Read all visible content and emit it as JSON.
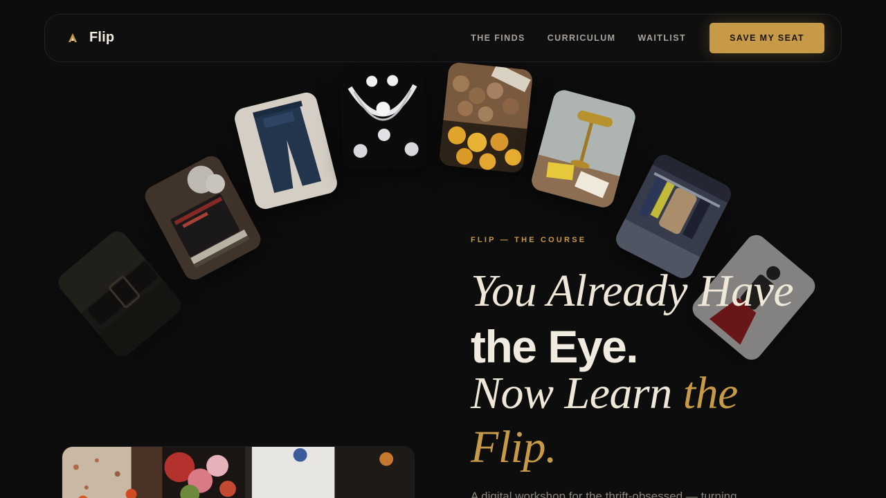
{
  "brand": {
    "name": "Flip",
    "logo_icon": "flip-logo-icon",
    "accent": "#c79a47"
  },
  "nav": {
    "links": [
      "THE FINDS",
      "CURRICULUM",
      "WAITLIST"
    ],
    "cta_label": "SAVE MY SEAT"
  },
  "hero": {
    "eyebrow": "FLIP — THE COURSE",
    "headline": {
      "line1": "You Already Have",
      "line2": "the Eye.",
      "line3_a": "Now Learn ",
      "line3_b": "the",
      "line4": "Flip."
    },
    "subtext": "A digital workshop for the thrift-obsessed — turning"
  },
  "gallery": {
    "tiles": [
      "leather-belt-photo",
      "old-books-photo",
      "denim-jacket-photo",
      "diamond-jewelry-photo",
      "walnuts-and-lemons-photo",
      "brass-lamp-photo",
      "clothing-rack-photo",
      "mannequin-photo"
    ],
    "bottom_image": "flower-market-photo"
  }
}
